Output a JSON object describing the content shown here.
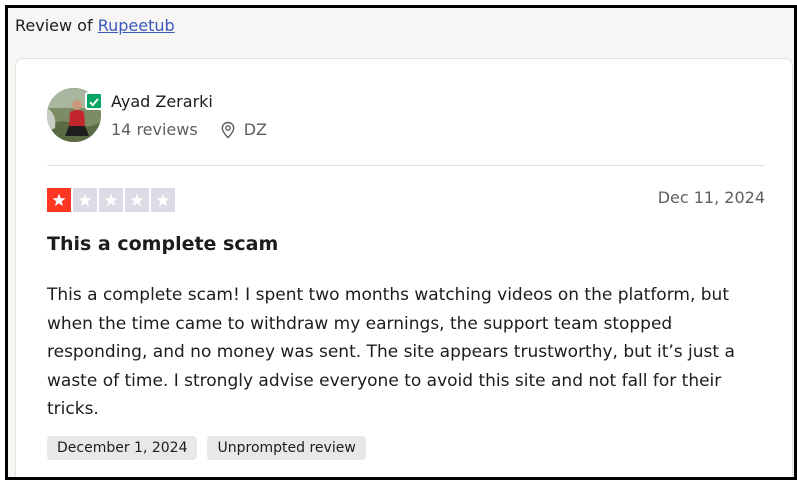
{
  "header": {
    "prefix": "Review of",
    "company_link": "Rupeetub"
  },
  "reviewer": {
    "name": "Ayad Zerarki",
    "reviews_count": "14 reviews",
    "country": "DZ"
  },
  "review": {
    "rating": 1,
    "max_rating": 5,
    "date": "Dec 11, 2024",
    "title": "This a complete scam",
    "body": "This a complete scam! I spent two months watching videos on the platform, but when the time came to withdraw my earnings, the support team stopped responding, and no money was sent. The site appears trustworthy, but it’s just a waste of time. I strongly advise everyone to avoid this site and not fall for their tricks.",
    "tags": [
      "December 1, 2024",
      "Unprompted review"
    ]
  },
  "colors": {
    "star_on": "#ff3722",
    "star_off": "#dcdce6",
    "verified": "#04a565",
    "link": "#3c57bc"
  }
}
